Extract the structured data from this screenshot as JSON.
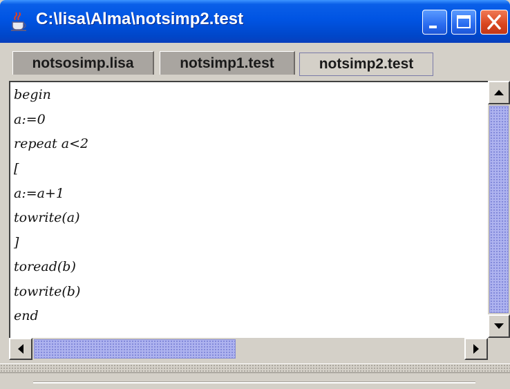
{
  "window": {
    "title": "C:\\lisa\\Alma\\notsimp2.test"
  },
  "tabs": [
    {
      "label": "notsosimp.lisa",
      "active": false
    },
    {
      "label": "notsimp1.test",
      "active": false
    },
    {
      "label": "notsimp2.test",
      "active": true
    }
  ],
  "editor": {
    "lines": [
      "begin",
      "a:=0",
      "repeat a<2",
      "[",
      "a:=a+1",
      "towrite(a)",
      "]",
      "toread(b)",
      "towrite(b)",
      "end"
    ]
  },
  "icons": {
    "app": "java-cup-icon",
    "minimize": "minimize-icon",
    "maximize": "maximize-icon",
    "close": "close-icon",
    "scroll_up": "arrow-up-icon",
    "scroll_down": "arrow-down-icon",
    "scroll_left": "arrow-left-icon",
    "scroll_right": "arrow-right-icon"
  },
  "colors": {
    "titlebar": "#0054e3",
    "close_button": "#d8451e",
    "scroll_thumb": "#aeb3ef",
    "background": "#d4d0c8"
  }
}
